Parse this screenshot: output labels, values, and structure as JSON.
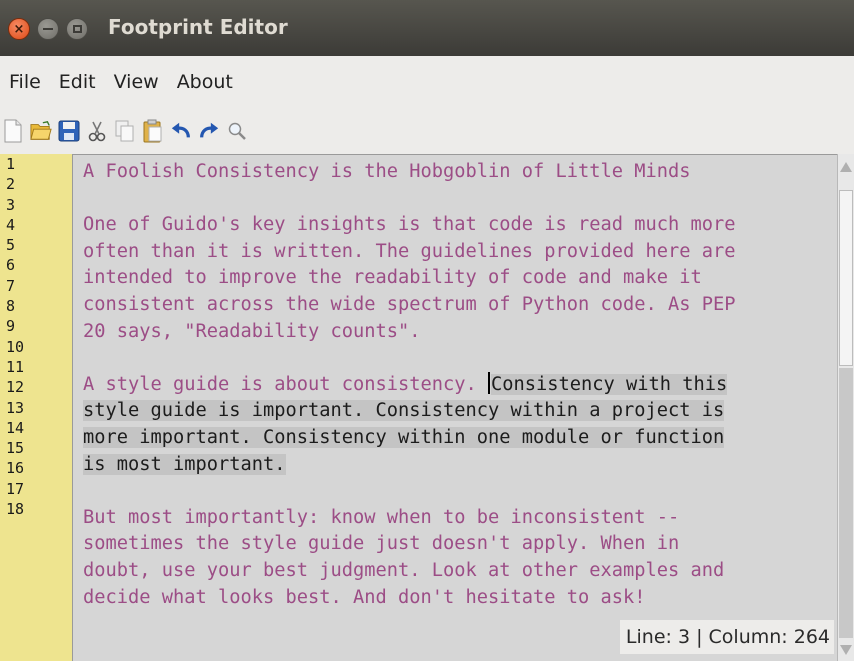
{
  "window": {
    "title": "Footprint Editor"
  },
  "menu": {
    "items": [
      "File",
      "Edit",
      "View",
      "About"
    ]
  },
  "toolbar": {
    "icons": [
      "new-file-icon",
      "open-folder-icon",
      "save-icon",
      "cut-icon",
      "copy-icon",
      "paste-icon",
      "undo-icon",
      "redo-icon",
      "search-icon"
    ]
  },
  "gutter": {
    "line_numbers": [
      "1",
      "2",
      "3",
      "4",
      "5",
      "6",
      "7",
      "8",
      "9",
      "10",
      "11",
      "12",
      "13",
      "14",
      "15",
      "16",
      "17",
      "18"
    ]
  },
  "editor": {
    "lines": [
      {
        "text": "A Foolish Consistency is the Hobgoblin of Little Minds"
      },
      {
        "text": ""
      },
      {
        "text": "One of Guido's key insights is that code is read much more"
      },
      {
        "text": "often than it is written. The guidelines provided here are"
      },
      {
        "text": "intended to improve the readability of code and make it"
      },
      {
        "text": "consistent across the wide spectrum of Python code. As PEP"
      },
      {
        "text": "20 says, \"Readability counts\"."
      },
      {
        "text": ""
      },
      {
        "text": "A style guide is about consistency. ",
        "selected": "Consistency with this"
      },
      {
        "text": "",
        "selected": "style guide is important. Consistency within a project is"
      },
      {
        "text": "",
        "selected": "more important. Consistency within one module or function"
      },
      {
        "text": "",
        "selected": "is most important."
      },
      {
        "text": ""
      },
      {
        "text": "But most importantly: know when to be inconsistent --"
      },
      {
        "text": "sometimes the style guide just doesn't apply. When in"
      },
      {
        "text": "doubt, use your best judgment. Look at other examples and"
      },
      {
        "text": "decide what looks best. And don't hesitate to ask!"
      }
    ]
  },
  "status": {
    "text": "Line: 3 | Column: 264"
  }
}
